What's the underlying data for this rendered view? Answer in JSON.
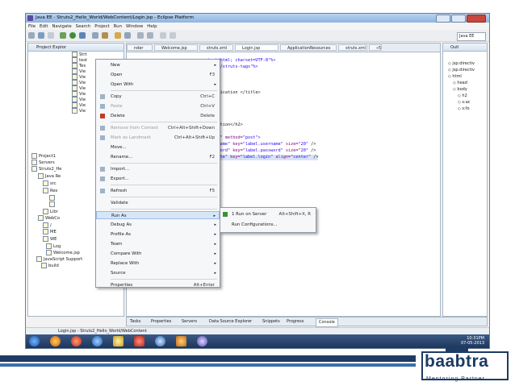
{
  "window": {
    "title": "Java EE - Struts2_Hello_World/WebContent/Login.jsp - Eclipse Platform"
  },
  "menubar": [
    "File",
    "Edit",
    "Navigate",
    "Search",
    "Project",
    "Run",
    "Window",
    "Help"
  ],
  "perspective": {
    "label": "Java EE"
  },
  "project_explorer": {
    "title": "Project Explor",
    "items": [
      "Strt",
      "test",
      "Tes",
      "Vie",
      "Vie",
      "Vie",
      "Vie",
      "Vie",
      "Vie",
      "Vie",
      "Vie",
      "Project1",
      "Servers",
      "Struts2_He",
      "Java Re",
      "src",
      "Res",
      "",
      "",
      "Libr",
      "WebCo",
      "/",
      "ME",
      "WE",
      "Log",
      "Welcome.jsp",
      "JavaScript Support",
      "build"
    ]
  },
  "editor_tabs": [
    "nder",
    "Welcome.jsp",
    "struts.xml",
    "Login.jsp",
    "ApplicationResources",
    "struts.xml",
    "»5"
  ],
  "code_lines": [
    {
      "parts": [
        [
          "st",
          "text/html; charset=UTF-8\"%>"
        ]
      ]
    },
    {
      "parts": [
        [
          "st",
          "uri=\"/struts-tags\"%>"
        ]
      ]
    },
    {
      "parts": [
        [
          "tx",
          " Application </title>"
        ]
      ]
    },
    {
      "parts": [
        [
          "tx",
          "plication</h2>"
        ]
      ]
    },
    {
      "parts": [
        [
          "st",
          "ction\""
        ],
        [
          "at",
          " method="
        ],
        [
          "st",
          "\"post\">"
        ]
      ]
    },
    {
      "parts": [
        [
          "st",
          "username\""
        ],
        [
          "at",
          " key="
        ],
        [
          "st",
          "\"label.username\""
        ],
        [
          "at",
          " size="
        ],
        [
          "st",
          "\"20\""
        ],
        [
          "tx",
          " />"
        ]
      ]
    },
    {
      "parts": [
        [
          "st",
          "password\""
        ],
        [
          "at",
          " key="
        ],
        [
          "st",
          "\"label.password\""
        ],
        [
          "at",
          " size="
        ],
        [
          "st",
          "\"20\""
        ],
        [
          "tx",
          " />"
        ]
      ]
    },
    {
      "parts": [
        [
          "st",
          "execute\""
        ],
        [
          "at",
          " key="
        ],
        [
          "st",
          "\"label.login\""
        ],
        [
          "at",
          " align="
        ],
        [
          "st",
          "\"center\""
        ],
        [
          "tx",
          " />"
        ]
      ]
    }
  ],
  "outline": {
    "title": "Outl",
    "items": [
      "jsp:directiv",
      "jsp:directiv",
      "html",
      "head",
      "body",
      "h2",
      "s:ac",
      "s:fo"
    ]
  },
  "context_menu": {
    "items": [
      {
        "label": "New",
        "accel": "",
        "submenu": true,
        "disabled": false
      },
      {
        "label": "Open",
        "accel": "F3",
        "submenu": false,
        "disabled": false
      },
      {
        "label": "Open With",
        "accel": "",
        "submenu": true,
        "disabled": false
      },
      {
        "label": "Copy",
        "accel": "Ctrl+C",
        "submenu": false,
        "disabled": false
      },
      {
        "label": "Paste",
        "accel": "Ctrl+V",
        "submenu": false,
        "disabled": true
      },
      {
        "label": "Delete",
        "accel": "Delete",
        "submenu": false,
        "disabled": false
      },
      {
        "label": "Remove from Context",
        "accel": "Ctrl+Alt+Shift+Down",
        "submenu": false,
        "disabled": true
      },
      {
        "label": "Mark as Landmark",
        "accel": "Ctrl+Alt+Shift+Up",
        "submenu": false,
        "disabled": true
      },
      {
        "label": "Move...",
        "accel": "",
        "submenu": false,
        "disabled": false
      },
      {
        "label": "Rename...",
        "accel": "F2",
        "submenu": false,
        "disabled": false
      },
      {
        "label": "Import...",
        "accel": "",
        "submenu": false,
        "disabled": false
      },
      {
        "label": "Export...",
        "accel": "",
        "submenu": false,
        "disabled": false
      },
      {
        "label": "Refresh",
        "accel": "F5",
        "submenu": false,
        "disabled": false
      },
      {
        "label": "Validate",
        "accel": "",
        "submenu": false,
        "disabled": false
      },
      {
        "label": "Run As",
        "accel": "",
        "submenu": true,
        "disabled": false
      },
      {
        "label": "Debug As",
        "accel": "",
        "submenu": true,
        "disabled": false
      },
      {
        "label": "Profile As",
        "accel": "",
        "submenu": true,
        "disabled": false
      },
      {
        "label": "Team",
        "accel": "",
        "submenu": true,
        "disabled": false
      },
      {
        "label": "Compare With",
        "accel": "",
        "submenu": true,
        "disabled": false
      },
      {
        "label": "Replace With",
        "accel": "",
        "submenu": true,
        "disabled": false
      },
      {
        "label": "Source",
        "accel": "",
        "submenu": true,
        "disabled": false
      },
      {
        "label": "Properties",
        "accel": "Alt+Enter",
        "submenu": false,
        "disabled": false
      }
    ],
    "highlighted": "Run As"
  },
  "run_as_submenu": [
    {
      "label": "1 Run on Server",
      "accel": "Alt+Shift+X, R"
    },
    {
      "label": "Run Configurations...",
      "accel": ""
    }
  ],
  "bottom_tabs": [
    "Tasks",
    "Properties",
    "Servers",
    "Data Source Explorer",
    "Snippets",
    "Progress",
    "Console"
  ],
  "statusbar": {
    "text": "Login.jsp - Struts2_Hello_World/WebContent"
  },
  "tray": {
    "time": "10:31PM",
    "date": "07-05-2013"
  },
  "logo": {
    "word": "baabtra",
    "tagline": "Mentoring Partner"
  },
  "colors": {
    "navy": "#1d3b63",
    "blue": "#3c6fa8",
    "highlight": "#d7e6f7"
  }
}
